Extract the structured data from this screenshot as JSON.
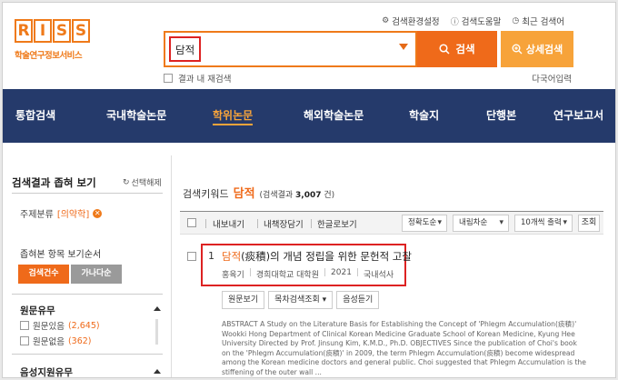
{
  "logo": {
    "letters": [
      "R",
      "I",
      "S",
      "S"
    ],
    "subtitle": "학술연구정보서비스"
  },
  "util": [
    {
      "icon": "gear-icon",
      "glyph": "⚙",
      "label": "검색환경설정"
    },
    {
      "icon": "info-icon",
      "glyph": "ⓘ",
      "label": "검색도움말"
    },
    {
      "icon": "clock-icon",
      "glyph": "◷",
      "label": "최근 검색어"
    }
  ],
  "search": {
    "value": "담적",
    "button": "검색",
    "advanced": "상세검색",
    "within": "결과 내 재검색",
    "multilang": "다국어입력"
  },
  "nav": [
    "통합검색",
    "국내학술논문",
    "학위논문",
    "해외학술논문",
    "학술지",
    "단행본",
    "연구보고서"
  ],
  "sidebar": {
    "title": "검색결과 좁혀 보기",
    "reset": "선택해제",
    "filter_label": "주제분류",
    "filter_value": "[의약학]",
    "sort_title": "좁혀본 항목 보기순서",
    "sort_a": "검색건수",
    "sort_b": "가나다순",
    "facet1": "원문유무",
    "facet1_items": [
      {
        "label": "원문있음",
        "count": "(2,645)"
      },
      {
        "label": "원문없음",
        "count": "(362)"
      }
    ],
    "facet2": "음성지원유무"
  },
  "results": {
    "kw_label": "검색키워드",
    "kw": "담적",
    "count_prefix": "(검색결과",
    "count": "3,007",
    "count_suffix": "건)",
    "toolbar": {
      "export": "내보내기",
      "save": "내책장담기",
      "email": "한글로보기"
    },
    "sort1": "정확도순",
    "sort2": "내림차순",
    "page_size": "10개씩 출력",
    "query": "조회",
    "items": [
      {
        "num": "1",
        "title_hl": "담적",
        "title_rest": "(痰積)의 개념 정립을 위한 문헌적 고찰",
        "author": "홍육기",
        "school": "경희대학교 대학원",
        "year": "2021",
        "type": "국내석사",
        "btn1": "원문보기",
        "btn2": "목차검색조회 ▾",
        "btn3": "음성듣기",
        "abstract": "ABSTRACT A Study on the Literature Basis for Establishing the Concept of 'Phlegm Accumulation(痰積)' Wookki Hong Department of Clinical Korean Medicine Graduate School of Korean Medicine, Kyung Hee University Directed by Prof. Jinsung Kim, K.M.D., Ph.D. OBJECTIVES Since the publication of Choi's book on the 'Phlegm Accumulation(痰積)' in 2009, the term Phlegm Accumulation(痰積) become widespread among the Korean medicine doctors and general public. Choi suggested that Phlegm Accumulation is the stiffening of the outer wall ..."
      }
    ]
  }
}
